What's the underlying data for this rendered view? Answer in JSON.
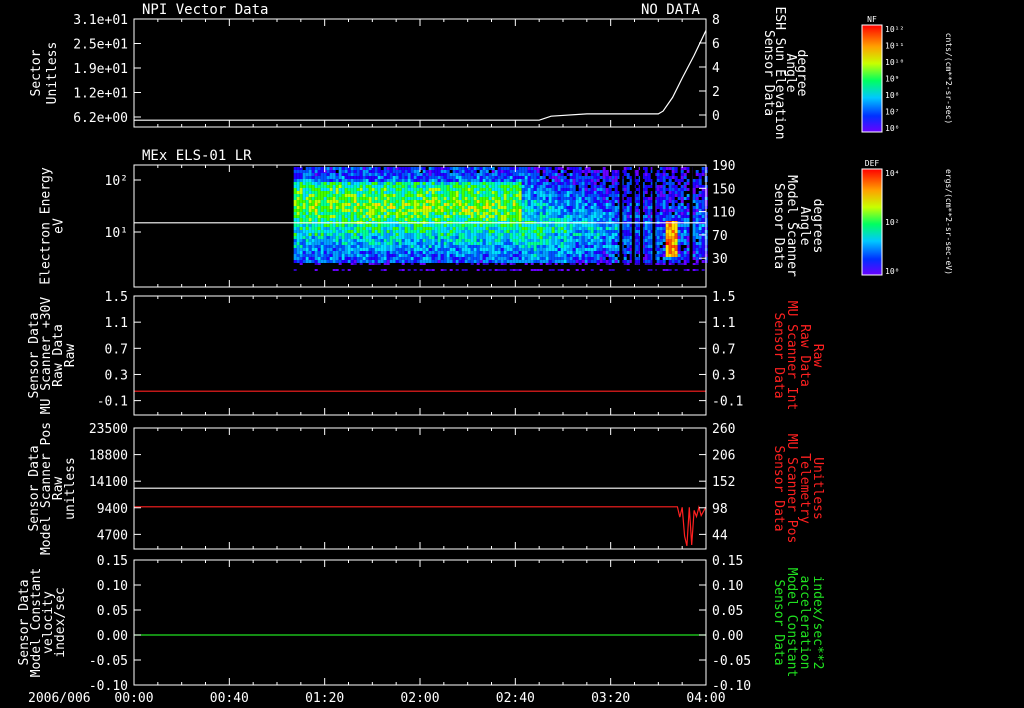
{
  "chart_data": [
    {
      "type": "line",
      "title": "NPI Vector Data",
      "status": "NO DATA",
      "left_axis": {
        "label_lines": [
          "Sector",
          "Unitless"
        ],
        "scale": "log",
        "ticks": [
          "3.1e+01",
          "2.5e+01",
          "1.9e+01",
          "1.2e+01",
          "6.2e+00"
        ]
      },
      "right_axis": {
        "label_lines": [
          "Sensor Data",
          "ESH Sun Elevation",
          "Angle",
          "degree"
        ],
        "ylim": [
          -1.5,
          8
        ],
        "ticks": [
          "8",
          "6",
          "4",
          "2",
          "0"
        ]
      },
      "series": [
        {
          "color": "#ffffff",
          "x": [
            "00:00",
            "02:50",
            "02:55",
            "03:10",
            "03:40",
            "03:42",
            "03:46",
            "03:50",
            "03:55",
            "04:00"
          ],
          "y": [
            -0.9,
            -0.9,
            -0.55,
            -0.35,
            -0.35,
            -0.1,
            1.1,
            2.8,
            4.8,
            7.0
          ]
        }
      ]
    },
    {
      "type": "heatmap",
      "title": "MEx ELS-01 LR",
      "left_axis": {
        "label_lines": [
          "Electron Energy",
          "eV"
        ],
        "scale": "log",
        "ticks": [
          "10²",
          "10¹"
        ]
      },
      "right_axis": {
        "label_lines": [
          "Sensor Data",
          "Model Scanner",
          "Angle",
          "degrees"
        ],
        "ylim": [
          0,
          190
        ],
        "ticks": [
          "190",
          "150",
          "110",
          "70",
          "30"
        ]
      },
      "series": [
        {
          "name": "Model Scanner Angle",
          "color": "#ffffff",
          "x": [
            "00:00",
            "04:00"
          ],
          "y": [
            100,
            100
          ]
        }
      ],
      "data_start": "01:07",
      "colorbar": {
        "title": "DEF",
        "unit": "ergs/(cm**2-sr-sec-eV)",
        "ticks": [
          "10⁴",
          "10²",
          "10⁰"
        ]
      }
    },
    {
      "type": "line",
      "left_axis": {
        "label_lines": [
          "Sensor Data",
          "MU Scanner +30V",
          "Raw Data",
          "Raw"
        ],
        "ylim": [
          -0.3,
          1.5
        ],
        "ticks": [
          "1.5",
          "1.1",
          "0.7",
          "0.3",
          "-0.1"
        ]
      },
      "right_axis": {
        "label_lines": [
          "Sensor Data",
          "MU Scanner Int",
          "Raw Data",
          "Raw"
        ],
        "color": "#ff2020",
        "ylim": [
          -0.3,
          1.5
        ],
        "ticks": [
          "1.5",
          "1.1",
          "0.7",
          "0.3",
          "-0.1"
        ]
      },
      "series": [
        {
          "color": "#ff2020",
          "x": [
            "00:00",
            "04:00"
          ],
          "y": [
            0.06,
            0.06
          ]
        }
      ]
    },
    {
      "type": "line",
      "left_axis": {
        "label_lines": [
          "Sensor Data",
          "Model Scanner Pos",
          "Raw",
          "unitless"
        ],
        "ylim": [
          0,
          23500
        ],
        "ticks": [
          "23500",
          "18800",
          "14100",
          "9400",
          "4700"
        ]
      },
      "right_axis": {
        "label_lines": [
          "Sensor Data",
          "MU Scanner Pos",
          "Telemetry",
          "Unitless"
        ],
        "color": "#ff2020",
        "ylim": [
          -10,
          260
        ],
        "ticks": [
          "260",
          "206",
          "152",
          "98",
          "44"
        ]
      },
      "series": [
        {
          "color": "#ffffff",
          "x": [
            "00:00",
            "04:00"
          ],
          "y": [
            11800,
            11800
          ]
        },
        {
          "color": "#ff2020",
          "x": [
            "00:00",
            "03:48",
            "03:49",
            "03:50",
            "03:51",
            "03:52",
            "03:53",
            "03:54",
            "03:55",
            "03:56",
            "03:57",
            "03:58",
            "04:00"
          ],
          "y": [
            8200,
            8200,
            6200,
            8100,
            2500,
            600,
            8100,
            800,
            7500,
            6300,
            8100,
            6500,
            8200
          ]
        }
      ]
    },
    {
      "type": "line",
      "left_axis": {
        "label_lines": [
          "Sensor Data",
          "Model Constant",
          "velocity",
          "index/sec"
        ],
        "ylim": [
          -0.1,
          0.15
        ],
        "ticks": [
          "0.15",
          "0.10",
          "0.05",
          "0.00",
          "-0.05",
          "-0.10"
        ]
      },
      "right_axis": {
        "label_lines": [
          "Sensor Data",
          "Model Constant",
          "acceleration",
          "index/sec**2"
        ],
        "color": "#20e020",
        "ylim": [
          -0.1,
          0.15
        ],
        "ticks": [
          "0.15",
          "0.10",
          "0.05",
          "0.00",
          "-0.05",
          "-0.10"
        ]
      },
      "series": [
        {
          "color": "#20e020",
          "x": [
            "00:00",
            "04:00"
          ],
          "y": [
            0,
            0
          ]
        }
      ]
    }
  ],
  "x_axis": {
    "date": "2006/006",
    "ticks": [
      "00:00",
      "00:40",
      "01:20",
      "02:00",
      "02:40",
      "03:20",
      "04:00"
    ]
  },
  "colorbar_top": {
    "title": "NF",
    "unit": "cnts/(cm**2-sr-sec)",
    "ticks": [
      "10¹²",
      "10¹¹",
      "10¹⁰",
      "10⁹",
      "10⁸",
      "10⁷",
      "10⁶"
    ]
  }
}
